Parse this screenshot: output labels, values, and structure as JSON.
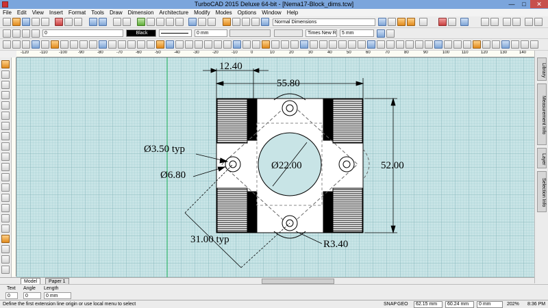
{
  "app": {
    "title": "TurboCAD 2015 Deluxe 64-bit - [Nema17-Block_dims.tcw]",
    "controls": {
      "minimize": "—",
      "maximize": "□",
      "close": "✕"
    }
  },
  "menu": [
    "File",
    "Edit",
    "View",
    "Insert",
    "Format",
    "Tools",
    "Draw",
    "Dimension",
    "Architecture",
    "Modify",
    "Modes",
    "Options",
    "Window",
    "Help"
  ],
  "property_bar": {
    "layer_value": "0",
    "color_value": "Black",
    "width_value": "0 mm",
    "dimension_style": "Normal Dimensions",
    "font": "Times New Ro",
    "text_size": "5 mm"
  },
  "ruler_labels": [
    "-120",
    "-110",
    "-100",
    "-90",
    "-80",
    "-70",
    "-60",
    "-50",
    "-40",
    "-30",
    "-20",
    "-10",
    "0",
    "10",
    "20",
    "30",
    "40",
    "50",
    "60",
    "70",
    "80",
    "90",
    "100",
    "110",
    "120",
    "130",
    "140"
  ],
  "drawing": {
    "dim_top_small": "12.40",
    "dim_top_width": "55.80",
    "dim_right_height": "52.00",
    "hole_note": "Ø3.50 typ",
    "bolt_note": "Ø6.80",
    "center_bore": "Ø22.00",
    "spacing_note": "31.00 typ",
    "radius_note": "R3.40"
  },
  "tabs": {
    "model": "Model",
    "paper": "Paper 1"
  },
  "side_panels": [
    "Library",
    "Measurement Info",
    "Layer",
    "Selection Info"
  ],
  "inspector": {
    "text_tab": "Text",
    "angle_tab": "Angle",
    "length_tab": "Length",
    "text_value": "0",
    "angle_value": "0",
    "length_value": "0 mm"
  },
  "status": {
    "prompt": "Define the first extension line origin or use local menu to select",
    "snap": "SNAP",
    "geo": "GEO",
    "x": "62.15 mm",
    "y": "60.24 mm",
    "z": "0 mm",
    "zoom": "202%",
    "clock": "8:36 PM"
  },
  "colors": {
    "canvas": "#c8e4e6",
    "titlebar": "#7ba5dc",
    "close": "#c7504c"
  }
}
